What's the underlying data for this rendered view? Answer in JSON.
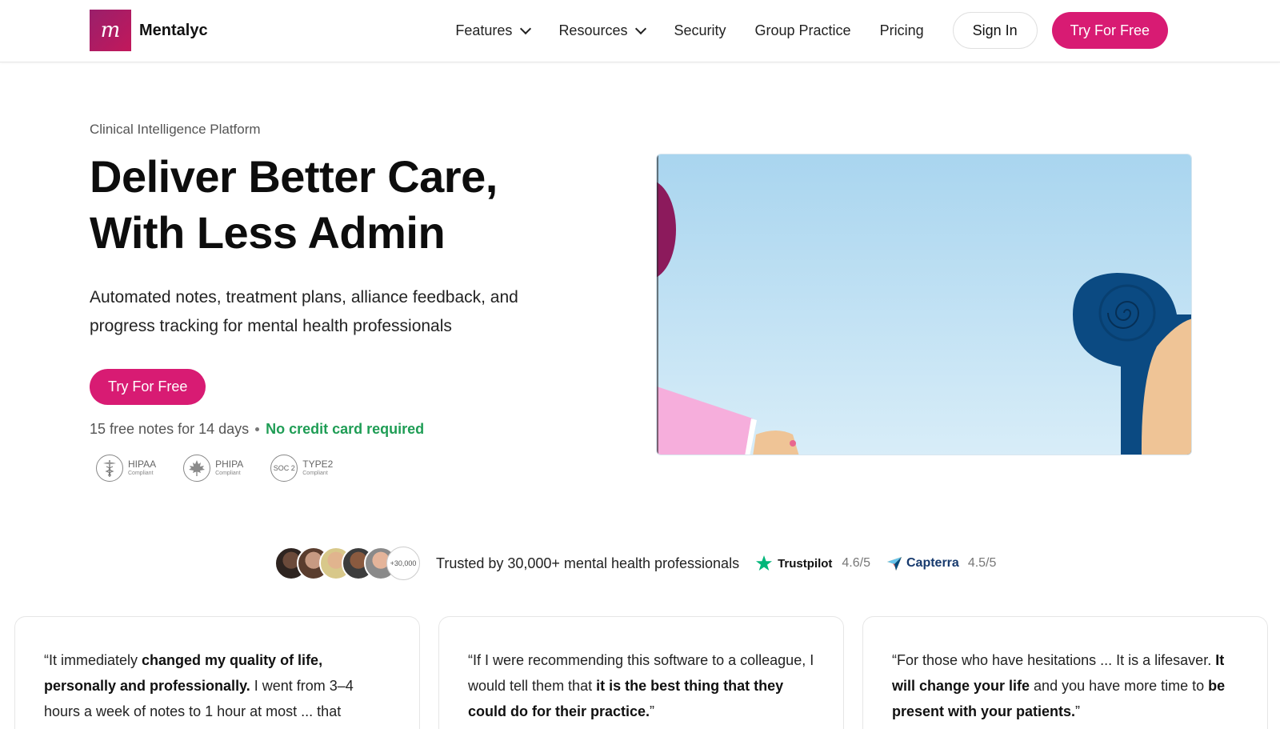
{
  "header": {
    "brand": "Mentalyc",
    "logo_letter": "m",
    "nav": [
      {
        "label": "Features",
        "has_dropdown": true
      },
      {
        "label": "Resources",
        "has_dropdown": true
      },
      {
        "label": "Security",
        "has_dropdown": false
      },
      {
        "label": "Group Practice",
        "has_dropdown": false
      },
      {
        "label": "Pricing",
        "has_dropdown": false
      }
    ],
    "sign_in": "Sign In",
    "cta": "Try For Free"
  },
  "hero": {
    "eyebrow": "Clinical Intelligence Platform",
    "title_line1": "Deliver Better Care,",
    "title_line2": "With Less Admin",
    "subtitle": "Automated notes, treatment plans, alliance feedback, and progress tracking for mental health professionals",
    "cta": "Try For Free",
    "free_notes": "15 free notes for 14 days",
    "no_card": "No credit card required",
    "badges": [
      {
        "icon": "caduceus-icon",
        "title": "HIPAA",
        "sub": "Compliant"
      },
      {
        "icon": "maple-leaf-icon",
        "title": "PHIPA",
        "sub": "Compliant"
      },
      {
        "icon": "soc2-icon",
        "title": "TYPE2",
        "sub": "Compliant",
        "icon_text": "SOC 2"
      }
    ]
  },
  "trust": {
    "avatar_count": "+30,000",
    "text": "Trusted by 30,000+ mental health professionals",
    "trustpilot": {
      "name": "Trustpilot",
      "rating": "4.6/5"
    },
    "capterra": {
      "name": "Capterra",
      "rating": "4.5/5"
    }
  },
  "testimonials": [
    {
      "parts": [
        {
          "t": "“It immediately ",
          "b": false
        },
        {
          "t": "changed my quality of life, personally and professionally.",
          "b": true
        },
        {
          "t": " I went from 3–4 hours a week of notes to 1 hour at most ... that",
          "b": false
        }
      ]
    },
    {
      "parts": [
        {
          "t": "“If I were recommending this software to a colleague, I would tell them that ",
          "b": false
        },
        {
          "t": "it is the best thing that they could do for their practice.",
          "b": true
        },
        {
          "t": "”",
          "b": false
        }
      ]
    },
    {
      "parts": [
        {
          "t": "“For those who have hesitations ... It is a lifesaver. ",
          "b": false
        },
        {
          "t": "It will change your life",
          "b": true
        },
        {
          "t": " and you have more time to ",
          "b": false
        },
        {
          "t": "be present with your patients.",
          "b": true
        },
        {
          "t": "”",
          "b": false
        }
      ]
    }
  ],
  "colors": {
    "brand_pink": "#d81b73",
    "logo_gradient": "#9a1f6b",
    "green": "#1f9d55",
    "trustpilot_green": "#00b67a",
    "capterra_navy": "#173a6e"
  }
}
